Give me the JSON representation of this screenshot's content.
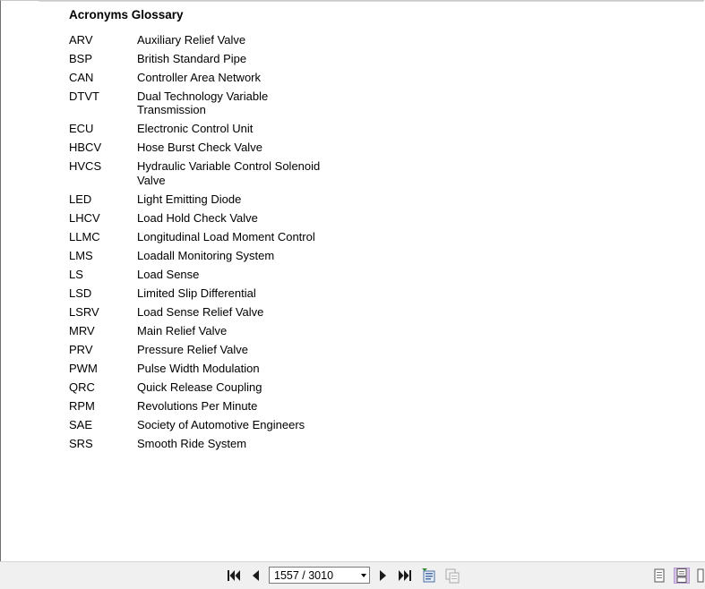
{
  "document": {
    "title": "Acronyms Glossary",
    "entries": [
      {
        "acronym": "ARV",
        "definition": "Auxiliary Relief Valve"
      },
      {
        "acronym": "BSP",
        "definition": "British Standard Pipe"
      },
      {
        "acronym": "CAN",
        "definition": "Controller Area Network"
      },
      {
        "acronym": "DTVT",
        "definition": "Dual Technology Variable Transmission"
      },
      {
        "acronym": "ECU",
        "definition": "Electronic Control Unit"
      },
      {
        "acronym": "HBCV",
        "definition": "Hose Burst Check Valve"
      },
      {
        "acronym": "HVCS",
        "definition": "Hydraulic Variable Control Solenoid Valve"
      },
      {
        "acronym": "LED",
        "definition": "Light Emitting Diode"
      },
      {
        "acronym": "LHCV",
        "definition": "Load Hold Check Valve"
      },
      {
        "acronym": "LLMC",
        "definition": "Longitudinal Load Moment Control"
      },
      {
        "acronym": "LMS",
        "definition": "Loadall Monitoring System"
      },
      {
        "acronym": "LS",
        "definition": "Load Sense"
      },
      {
        "acronym": "LSD",
        "definition": "Limited Slip Differential"
      },
      {
        "acronym": "LSRV",
        "definition": "Load Sense Relief Valve"
      },
      {
        "acronym": "MRV",
        "definition": "Main Relief Valve"
      },
      {
        "acronym": "PRV",
        "definition": "Pressure Relief Valve"
      },
      {
        "acronym": "PWM",
        "definition": "Pulse Width Modulation"
      },
      {
        "acronym": "QRC",
        "definition": "Quick Release Coupling"
      },
      {
        "acronym": "RPM",
        "definition": "Revolutions Per Minute"
      },
      {
        "acronym": "SAE",
        "definition": "Society of Automotive Engineers"
      },
      {
        "acronym": "SRS",
        "definition": "Smooth Ride System"
      }
    ]
  },
  "toolbar": {
    "page_indicator": "1557 / 3010",
    "icons": {
      "first": "first-page-icon",
      "prev": "previous-page-icon",
      "next": "next-page-icon",
      "last": "last-page-icon",
      "goto": "go-to-page-icon",
      "copy": "copy-page-icon",
      "single": "single-page-view-icon",
      "continuous": "continuous-view-icon",
      "facing": "facing-pages-view-icon"
    },
    "colors": {
      "background": "#f0f0f0",
      "active_view": "#d7c3e8"
    }
  }
}
